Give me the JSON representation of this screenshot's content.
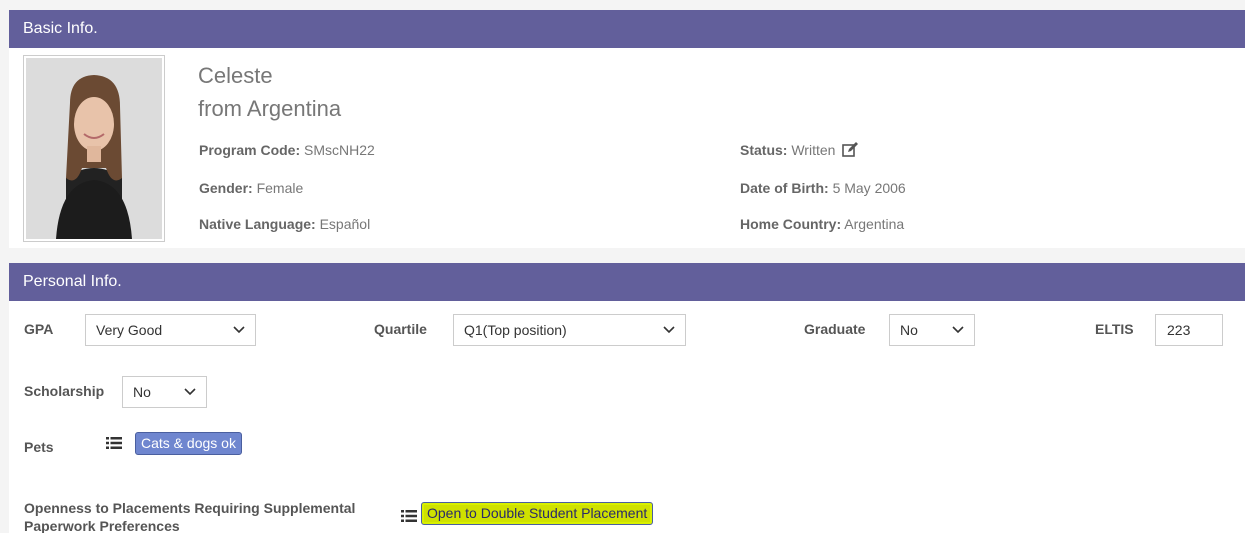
{
  "basic": {
    "header": "Basic Info.",
    "name": "Celeste",
    "from": "from Argentina",
    "program_code_label": "Program Code:",
    "program_code": "SMscNH22",
    "gender_label": "Gender:",
    "gender": "Female",
    "native_language_label": "Native Language:",
    "native_language": "Español",
    "status_label": "Status:",
    "status": "Written",
    "dob_label": "Date of Birth:",
    "dob": "5 May 2006",
    "home_country_label": "Home Country:",
    "home_country": "Argentina"
  },
  "personal": {
    "header": "Personal Info.",
    "gpa_label": "GPA",
    "gpa_value": "Very Good",
    "quartile_label": "Quartile",
    "quartile_value": "Q1(Top position)",
    "graduate_label": "Graduate",
    "graduate_value": "No",
    "eltis_label": "ELTIS",
    "eltis_value": "223",
    "scholarship_label": "Scholarship",
    "scholarship_value": "No",
    "pets_label": "Pets",
    "pets_tag": "Cats & dogs ok",
    "openness_label_line1": "Openness to Placements Requiring Supplemental",
    "openness_label_line2": "Paperwork Preferences",
    "openness_tag": "Open to Double Student Placement"
  },
  "colors": {
    "header_bg": "#625f9b",
    "tag_bg": "#6f86cf",
    "highlight": "#cfe100"
  }
}
